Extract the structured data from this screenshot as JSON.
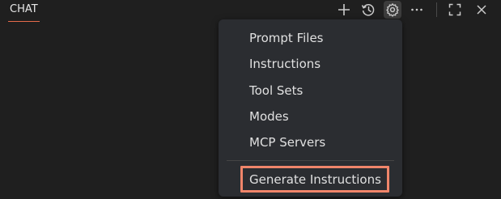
{
  "panel": {
    "tab_label": "CHAT"
  },
  "toolbar": {
    "icons": [
      "plus-icon",
      "history-icon",
      "gear-icon",
      "more-icon",
      "maximize-icon",
      "close-icon"
    ]
  },
  "menu": {
    "items": [
      {
        "label": "Prompt Files"
      },
      {
        "label": "Instructions"
      },
      {
        "label": "Tool Sets"
      },
      {
        "label": "Modes"
      },
      {
        "label": "MCP Servers"
      }
    ],
    "footer_item": {
      "label": "Generate Instructions"
    }
  },
  "colors": {
    "background": "#1f1f1f",
    "menu_background": "#2b2d31",
    "tab_underline": "#e56b4a",
    "highlight_border": "#f0856a"
  }
}
